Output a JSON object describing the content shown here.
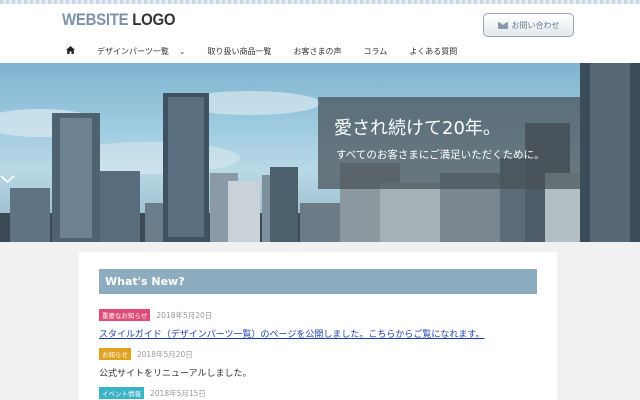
{
  "header": {
    "logo_a": "WEBSITE",
    "logo_b": " LOGO",
    "contact_label": "お問い合わせ"
  },
  "nav": {
    "items": [
      "デザインパーツ一覧",
      "取り扱い商品一覧",
      "お客さまの声",
      "コラム",
      "よくある質問"
    ]
  },
  "hero": {
    "catch": "愛され続けて20年。",
    "subcatch": "すべてのお客さまにご満足いただくために。"
  },
  "news": {
    "heading": "What's New?",
    "items": [
      {
        "tag": "重要なお知らせ",
        "tag_color": "#e04a77",
        "date": "2018年5月20日",
        "text": "スタイルガイド（デザインパーツ一覧）のページを公開しました。こちらからご覧になれます。",
        "is_link": true
      },
      {
        "tag": "お知らせ",
        "tag_color": "#e0a21f",
        "date": "2018年5月20日",
        "text": "公式サイトをリニューアルしました。",
        "is_link": false
      },
      {
        "tag": "イベント情報",
        "tag_color": "#3bb3c6",
        "date": "2018年5月15日",
        "text": "",
        "is_link": false
      }
    ]
  },
  "colors": {
    "accent": "#8dacc0",
    "link": "#1a3fb0",
    "header_bg": "#ffffff",
    "page_bg": "#f1f1f1"
  }
}
